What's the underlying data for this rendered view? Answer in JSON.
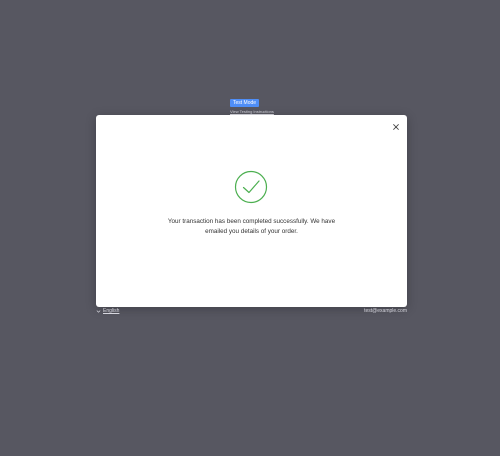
{
  "header": {
    "test_mode_label": "Test Mode",
    "testing_link_label": "View Testing Instructions"
  },
  "modal": {
    "close_icon": "close-icon",
    "success_icon": "checkmark-circle-icon",
    "message": "Your transaction has been completed successfully. We have emailed you details of your order."
  },
  "footer": {
    "language_icon": "chevron-down-icon",
    "language_label": "English",
    "email": "test@example.com"
  },
  "colors": {
    "background": "#575761",
    "badge": "#4f8ef7",
    "success": "#4caf50"
  }
}
